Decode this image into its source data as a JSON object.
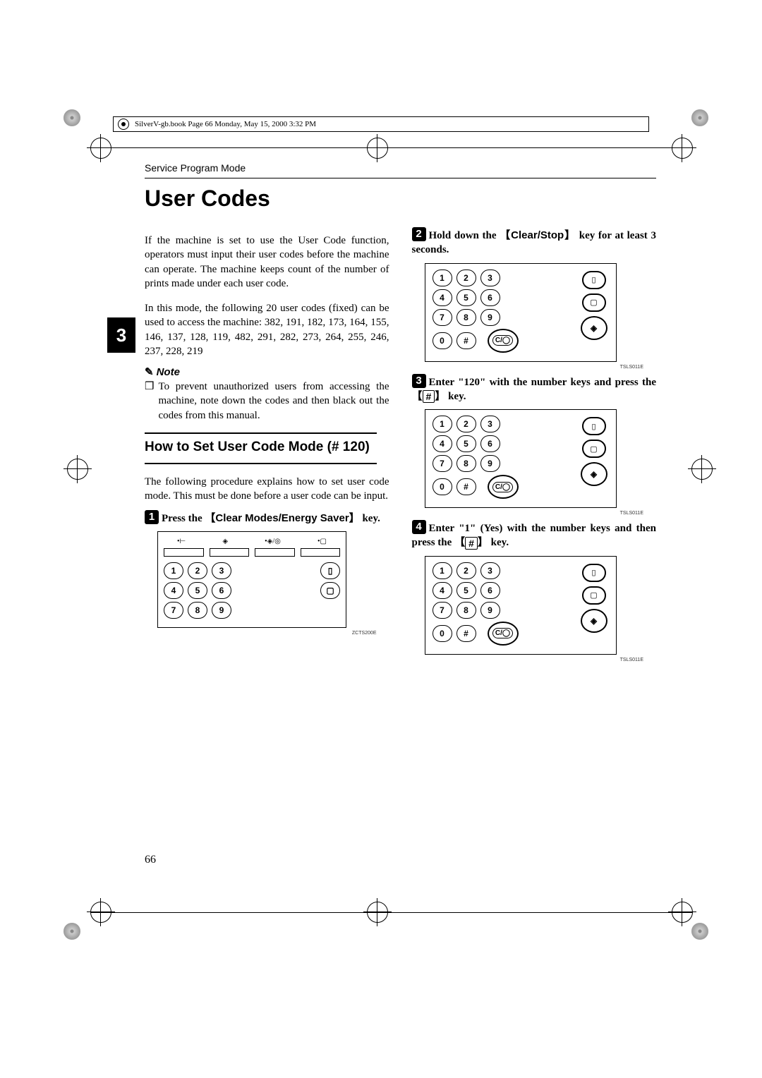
{
  "header_line": "SilverV-gb.book  Page 66  Monday, May 15, 2000  3:32 PM",
  "section": "Service Program Mode",
  "title": "User Codes",
  "chapter_tab": "3",
  "page_number": "66",
  "intro_p1": "If the machine is set to use the User Code function, operators must input their user codes before the machine can operate. The machine keeps count of the number of prints made under each user code.",
  "intro_p2": "In this mode, the following 20 user codes (fixed) can be used to access the machine: 382, 191, 182, 173, 164, 155, 146, 137, 128, 119, 482, 291, 282, 273, 264, 255, 246, 237, 228, 219",
  "note_label": "Note",
  "note_text": "To prevent unauthorized users from accessing the machine, note down the codes and then black out the codes from this manual.",
  "subhead": "How to Set User Code Mode (# 120)",
  "sub_intro": "The following procedure explains how to set user code mode. This must be done before a user code can be input.",
  "step1_a": "Press the ",
  "step1_key": "Clear Modes/Energy Saver",
  "step1_b": " key.",
  "step2_a": "Hold down the ",
  "step2_key": "Clear/Stop",
  "step2_b": " key for at least 3 seconds.",
  "step3_a": "Enter \"120\" with the number keys and press the ",
  "step3_b": " key.",
  "step4_a": "Enter \"1\" (Yes) with the number keys and then press the ",
  "step4_b": " key.",
  "fig1": "ZCTS200E",
  "fig2": "TSLS011E",
  "fig3": "TSLS011E",
  "fig4": "TSLS011E",
  "keys": {
    "1": "1",
    "2": "2",
    "3": "3",
    "4": "4",
    "5": "5",
    "6": "6",
    "7": "7",
    "8": "8",
    "9": "9",
    "0": "0",
    "hash": "#",
    "cs": "C/◯"
  },
  "hash_glyph": "#"
}
